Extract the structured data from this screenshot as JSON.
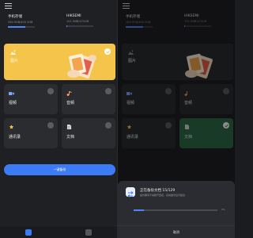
{
  "storage": [
    {
      "name": "手机存储",
      "size": "264.9GB/405.3GB",
      "fill": 0.65
    },
    {
      "name": "HIKSEMI",
      "size": "151.5MB/472GB",
      "fill": 0.0
    }
  ],
  "categories": {
    "photo": {
      "label": "图片",
      "sub": "",
      "selected": true
    },
    "video": {
      "label": "视频",
      "sub": "",
      "selected": false
    },
    "audio": {
      "label": "音频",
      "sub": "",
      "selected": false
    },
    "contacts": {
      "label": "通讯录",
      "sub": "",
      "selected": false
    },
    "docs": {
      "label": "文档",
      "sub": "",
      "selected": false
    }
  },
  "backup_button": "一键备份",
  "tabs": [
    {
      "name": "home-tab",
      "active": true
    },
    {
      "name": "files-tab",
      "active": false
    }
  ],
  "dialog": {
    "title": "正在备份文档 15/129",
    "desc": "备份期间不得断开连接，完成备份后可拔出",
    "progress": 0.12,
    "percent": "1%",
    "cancel": "取消"
  },
  "colors": {
    "accent": "#3b7bf6",
    "photo_card": "#f4c54a",
    "selected_green": "#2f6b46",
    "background": "#1f2023"
  }
}
